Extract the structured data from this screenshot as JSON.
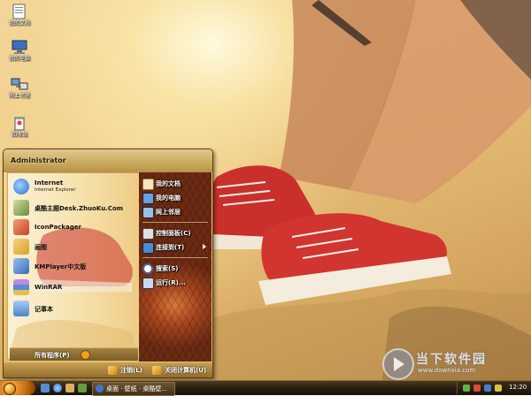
{
  "desktop": {
    "icons": [
      {
        "label": "我的文档",
        "icon": "my-documents-icon"
      },
      {
        "label": "我的电脑",
        "icon": "my-computer-icon"
      },
      {
        "label": "网上邻居",
        "icon": "network-places-icon"
      },
      {
        "label": "回收站",
        "icon": "recycle-bin-icon"
      }
    ]
  },
  "start_menu": {
    "user_name": "Administrator",
    "left_items": [
      {
        "title": "Internet",
        "subtitle": "Internet Explorer",
        "icon": "internet-explorer-icon",
        "color": "#2f6fd0"
      },
      {
        "title": "桌酷主题Desk.ZhuoKu.Com",
        "subtitle": "",
        "icon": "zhuoku-theme-icon",
        "color": "#6a8a3a"
      },
      {
        "title": "IconPackager",
        "subtitle": "",
        "icon": "iconpackager-icon",
        "color": "#c8402a"
      },
      {
        "title": "画图",
        "subtitle": "",
        "icon": "paint-icon",
        "color": "#d9a030"
      },
      {
        "title": "KMPlayer中文版",
        "subtitle": "",
        "icon": "kmplayer-icon",
        "color": "#3a6ab8"
      },
      {
        "title": "WinRAR",
        "subtitle": "",
        "icon": "winrar-icon",
        "color": "#7a4aa0"
      },
      {
        "title": "记事本",
        "subtitle": "",
        "icon": "notepad-icon",
        "color": "#4a86c8"
      }
    ],
    "all_programs_label": "所有程序(P)",
    "right_items": [
      {
        "label": "我的文档",
        "icon": "my-documents-icon",
        "has_arrow": false
      },
      {
        "label": "我的电脑",
        "icon": "my-computer-icon",
        "has_arrow": false
      },
      {
        "label": "网上邻居",
        "icon": "network-places-icon",
        "has_arrow": false
      },
      {
        "label": "控制面板(C)",
        "icon": "control-panel-icon",
        "has_arrow": false
      },
      {
        "label": "连接到(T)",
        "icon": "connect-to-icon",
        "has_arrow": true
      },
      {
        "label": "搜索(S)",
        "icon": "search-icon",
        "has_arrow": false
      },
      {
        "label": "运行(R)...",
        "icon": "run-icon",
        "has_arrow": false
      }
    ],
    "logoff_label": "注销(L)",
    "shutdown_label": "关闭计算机(U)"
  },
  "taskbar": {
    "task_label": "桌面 · 壁纸 · 桌酷壁...",
    "clock": "12:20"
  },
  "watermark": {
    "title": "当下软件园",
    "url": "www.downxia.com"
  },
  "colors": {
    "accent": "#e59a1a",
    "menu_right_bg": "#8a3a17",
    "taskbar_bg": "#2a1f11"
  }
}
